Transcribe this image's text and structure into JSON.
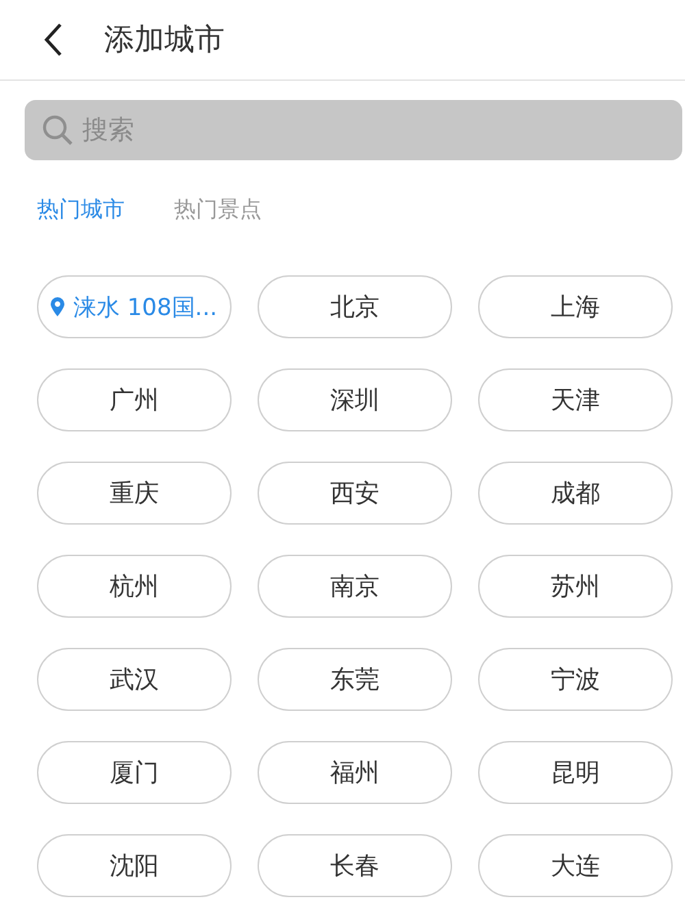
{
  "header": {
    "title": "添加城市"
  },
  "search": {
    "placeholder": "搜索"
  },
  "tabs": [
    {
      "label": "热门城市",
      "selected": true
    },
    {
      "label": "热门景点",
      "selected": false
    }
  ],
  "cities": [
    {
      "name": "涞水 108国...",
      "kind": "location"
    },
    {
      "name": "北京",
      "kind": "city"
    },
    {
      "name": "上海",
      "kind": "city"
    },
    {
      "name": "广州",
      "kind": "city"
    },
    {
      "name": "深圳",
      "kind": "city"
    },
    {
      "name": "天津",
      "kind": "city"
    },
    {
      "name": "重庆",
      "kind": "city"
    },
    {
      "name": "西安",
      "kind": "city"
    },
    {
      "name": "成都",
      "kind": "city"
    },
    {
      "name": "杭州",
      "kind": "city"
    },
    {
      "name": "南京",
      "kind": "city"
    },
    {
      "name": "苏州",
      "kind": "city"
    },
    {
      "name": "武汉",
      "kind": "city"
    },
    {
      "name": "东莞",
      "kind": "city"
    },
    {
      "name": "宁波",
      "kind": "city"
    },
    {
      "name": "厦门",
      "kind": "city"
    },
    {
      "name": "福州",
      "kind": "city"
    },
    {
      "name": "昆明",
      "kind": "city"
    },
    {
      "name": "沈阳",
      "kind": "city"
    },
    {
      "name": "长春",
      "kind": "city"
    },
    {
      "name": "大连",
      "kind": "city"
    }
  ]
}
